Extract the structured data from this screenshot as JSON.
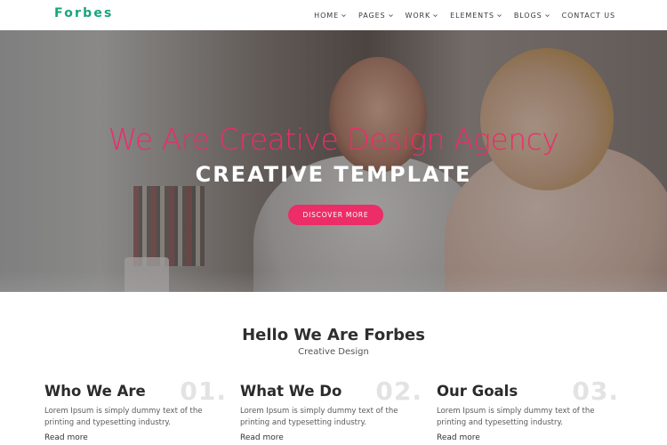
{
  "brand": {
    "name": "Forbes",
    "color": "#1aa37a"
  },
  "nav": {
    "items": [
      {
        "label": "HOME",
        "dropdown": true
      },
      {
        "label": "PAGES",
        "dropdown": true
      },
      {
        "label": "WORK",
        "dropdown": true
      },
      {
        "label": "ELEMENTS",
        "dropdown": true
      },
      {
        "label": "BLOGS",
        "dropdown": true
      },
      {
        "label": "CONTACT US",
        "dropdown": false
      }
    ]
  },
  "hero": {
    "title": "We Are Creative Design Agency",
    "subtitle": "CREATIVE TEMPLATE",
    "button_label": "DISCOVER MORE",
    "accent_color": "#ec2d67"
  },
  "about": {
    "title": "Hello We Are Forbes",
    "subtitle": "Creative Design",
    "cards": [
      {
        "number": "01.",
        "title": "Who We Are",
        "text": "Lorem Ipsum is simply dummy text of the printing and typesetting industry.",
        "link": "Read more"
      },
      {
        "number": "02.",
        "title": "What We Do",
        "text": "Lorem Ipsum is simply dummy text of the printing and typesetting industry.",
        "link": "Read more"
      },
      {
        "number": "03.",
        "title": "Our Goals",
        "text": "Lorem Ipsum is simply dummy text of the printing and typesetting industry.",
        "link": "Read more"
      }
    ]
  }
}
